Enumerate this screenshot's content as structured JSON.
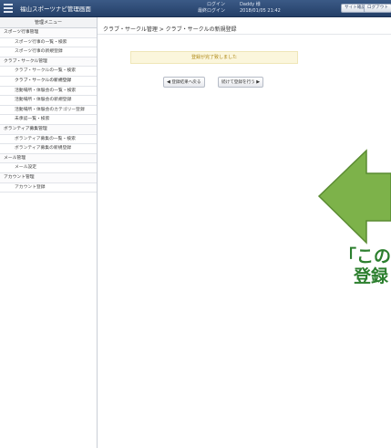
{
  "header": {
    "app_title": "福山スポーツナビ管理画面",
    "login_label": "ログイン",
    "last_login_label": "最終ログイン",
    "login_value": "Daddy 様",
    "last_login_value": "2018/01/05 21:42",
    "site_button": "サイト確認",
    "logout_button": "ログアウト"
  },
  "sidebar": {
    "header": "管理メニュー",
    "items": [
      {
        "label": "スポーツ行事管理",
        "type": "cat"
      },
      {
        "label": "スポーツ行事の一覧・検索",
        "type": "sub"
      },
      {
        "label": "スポーツ行事の新規登録",
        "type": "sub"
      },
      {
        "label": "クラブ・サークル管理",
        "type": "cat"
      },
      {
        "label": "クラブ・サークルの一覧・検索",
        "type": "sub"
      },
      {
        "label": "クラブ・サークルの新規登録",
        "type": "sub"
      },
      {
        "label": "活動場所・体験会の一覧・検索",
        "type": "sub"
      },
      {
        "label": "活動場所・体験会の新規登録",
        "type": "sub"
      },
      {
        "label": "活動場所・体験会のカテゴリー登録",
        "type": "sub"
      },
      {
        "label": "未承認一覧・検索",
        "type": "sub"
      },
      {
        "label": "ボランティア募集管理",
        "type": "cat"
      },
      {
        "label": "ボランティア募集の一覧・検索",
        "type": "sub"
      },
      {
        "label": "ボランティア募集の新規登録",
        "type": "sub"
      },
      {
        "label": "メール管理",
        "type": "cat"
      },
      {
        "label": "メール設定",
        "type": "sub"
      },
      {
        "label": "アカウント管理",
        "type": "cat"
      },
      {
        "label": "アカウント登録",
        "type": "sub"
      }
    ]
  },
  "main": {
    "breadcrumb": "クラブ・サークル管理 > クラブ・サークルの新規登録",
    "message": "登録が完了致しました",
    "back_button": "登録結果へ戻る",
    "next_button": "続けて登録を行う"
  },
  "annotation": {
    "line1": "「この",
    "line2": "登録",
    "color": "#2c7f2e",
    "arrow_color": "#7db24a"
  }
}
